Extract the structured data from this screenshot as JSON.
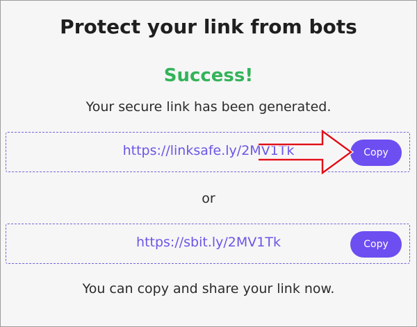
{
  "header": {
    "title": "Protect your link from bots"
  },
  "status": {
    "heading": "Success!",
    "message": "Your secure link has been generated."
  },
  "links": [
    {
      "url": "https://linksafe.ly/2MV1Tk",
      "copy_label": "Copy"
    },
    {
      "url": "https://sbit.ly/2MV1Tk",
      "copy_label": "Copy"
    }
  ],
  "separator": "or",
  "footer": {
    "message": "You can copy and share your link now."
  },
  "colors": {
    "success": "#33b35a",
    "accent": "#6d4ef0",
    "link": "#6a56e6",
    "annotation": "#e0101a"
  },
  "annotation": {
    "icon": "red-arrow-icon"
  }
}
